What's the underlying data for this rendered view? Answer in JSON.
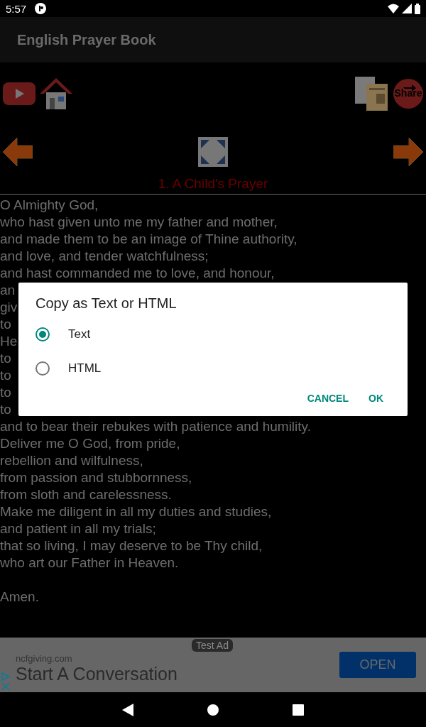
{
  "status_bar": {
    "time": "5:57"
  },
  "app_bar": {
    "title": "English Prayer Book"
  },
  "toolbar": {
    "share_label": "Share"
  },
  "prayer": {
    "title": "1. A Child's Prayer",
    "stanzas": [
      [
        "O Almighty God,",
        "who hast given unto me my father and mother,",
        "and made them to be an image of Thine authority,",
        "and love, and tender watchfulness;",
        "and hast commanded me to love, and honour,",
        "an",
        "giv",
        "to",
        "He",
        "to",
        "to",
        "to",
        "to",
        "and to bear their rebukes with patience and humility.",
        "Deliver me O God, from pride,",
        "rebellion and wilfulness,",
        "from passion and stubbornness,",
        "from sloth and carelessness.",
        "Make me diligent in all my duties and studies,",
        "and patient in all my trials;",
        "that so living, I may deserve to be Thy child,",
        "who art our Father in Heaven."
      ],
      [
        "Amen."
      ]
    ]
  },
  "dialog": {
    "title": "Copy as Text or HTML",
    "options": [
      {
        "label": "Text",
        "selected": true
      },
      {
        "label": "HTML",
        "selected": false
      }
    ],
    "buttons": [
      "CANCEL",
      "OK"
    ]
  },
  "ad": {
    "badge": "Test Ad",
    "domain": "ncfgiving.com",
    "headline": "Start A Conversation",
    "button": "OPEN"
  }
}
